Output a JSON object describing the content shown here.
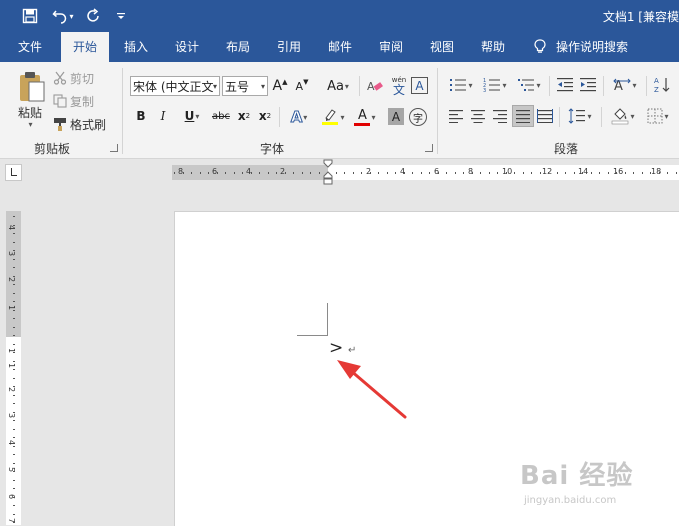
{
  "window": {
    "title": "文档1 [兼容模"
  },
  "tabs": [
    {
      "label": "文件"
    },
    {
      "label": "开始"
    },
    {
      "label": "插入"
    },
    {
      "label": "设计"
    },
    {
      "label": "布局"
    },
    {
      "label": "引用"
    },
    {
      "label": "邮件"
    },
    {
      "label": "审阅"
    },
    {
      "label": "视图"
    },
    {
      "label": "帮助"
    },
    {
      "label": "操作说明搜索"
    }
  ],
  "clipboard": {
    "paste": "粘贴",
    "cut": "剪切",
    "copy": "复制",
    "format_painter": "格式刷",
    "group_label": "剪贴板"
  },
  "font": {
    "font_name": "宋体 (中文正文",
    "font_size": "五号",
    "bold": "B",
    "italic": "I",
    "underline": "U",
    "strikethrough": "abc",
    "subscript": "x",
    "subscript_mark": "2",
    "superscript": "x",
    "superscript_mark": "2",
    "grow": "A",
    "shrink": "A",
    "change_case": "Aa",
    "phonetic_top": "wén",
    "phonetic_bottom": "文",
    "char_border": "A",
    "text_effect": "A",
    "font_color": "A",
    "char_shading": "A",
    "enclose": "字",
    "group_label": "字体",
    "font_color_value": "#e00000",
    "highlight_color_value": "#ffff00"
  },
  "paragraph": {
    "group_label": "段落"
  },
  "ruler": {
    "h_labels": [
      "8",
      "6",
      "4",
      "2",
      "2",
      "4",
      "6",
      "8",
      "10",
      "12",
      "14",
      "16",
      "18"
    ],
    "v_labels": [
      "4",
      "3",
      "2",
      "1",
      "1",
      "1",
      "2",
      "3",
      "4",
      "5",
      "6",
      "7"
    ]
  },
  "document": {
    "text": ">",
    "paragraph_mark": "↵"
  },
  "watermark": {
    "main": "Bai 经验",
    "sub": "jingyan.baidu.com"
  }
}
